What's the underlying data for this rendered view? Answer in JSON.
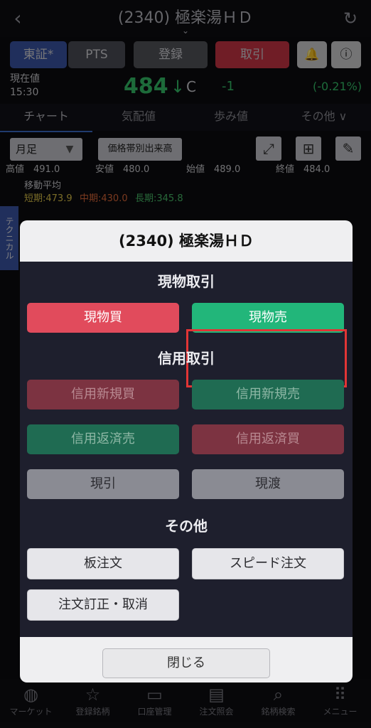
{
  "header": {
    "back_icon": "chevron-left-icon",
    "title": "(2340) 極楽湯ＨＤ",
    "reload_icon": "refresh-icon"
  },
  "toolbar": {
    "market_tse": "東証*",
    "market_pts": "PTS",
    "register": "登録",
    "trade": "取引"
  },
  "price": {
    "label": "現在値",
    "time": "15:30",
    "value": "484",
    "flag": "C",
    "change": "-1",
    "change_pct": "(-0.21%)",
    "down_color": "#35c46a"
  },
  "tabs": [
    "チャート",
    "気配値",
    "歩み値",
    "その他 ∨"
  ],
  "chart": {
    "period": "月足",
    "volume_button": "価格帯別出来高",
    "high": "高値　491.0",
    "low": "安値　480.0",
    "open": "始値　489.0",
    "close": "終値　484.0",
    "ma_label": "移動平均",
    "ma_short": "短期:473.9",
    "ma_mid": "中期:430.0",
    "ma_long": "長期:345.8",
    "technical_tab": "テクニカル"
  },
  "modal": {
    "title": "(2340) 極楽湯ＨＤ",
    "section_cash": "現物取引",
    "cash_buy": "現物買",
    "cash_sell": "現物売",
    "section_margin": "信用取引",
    "margin_new_buy": "信用新規買",
    "margin_new_sell": "信用新規売",
    "margin_repay_sell": "信用返済売",
    "margin_repay_buy": "信用返済買",
    "genbiki": "現引",
    "genwatashi": "現渡",
    "section_other": "その他",
    "board_order": "板注文",
    "speed_order": "スピード注文",
    "order_modify": "注文訂正・取消",
    "close": "閉じる"
  },
  "bottom_nav": [
    {
      "label": "マーケット",
      "icon": "globe-icon"
    },
    {
      "label": "登録銘柄",
      "icon": "star-icon"
    },
    {
      "label": "口座管理",
      "icon": "wallet-icon"
    },
    {
      "label": "注文照会",
      "icon": "document-icon"
    },
    {
      "label": "銘柄検索",
      "icon": "search-icon"
    },
    {
      "label": "メニュー",
      "icon": "grid-icon"
    }
  ]
}
